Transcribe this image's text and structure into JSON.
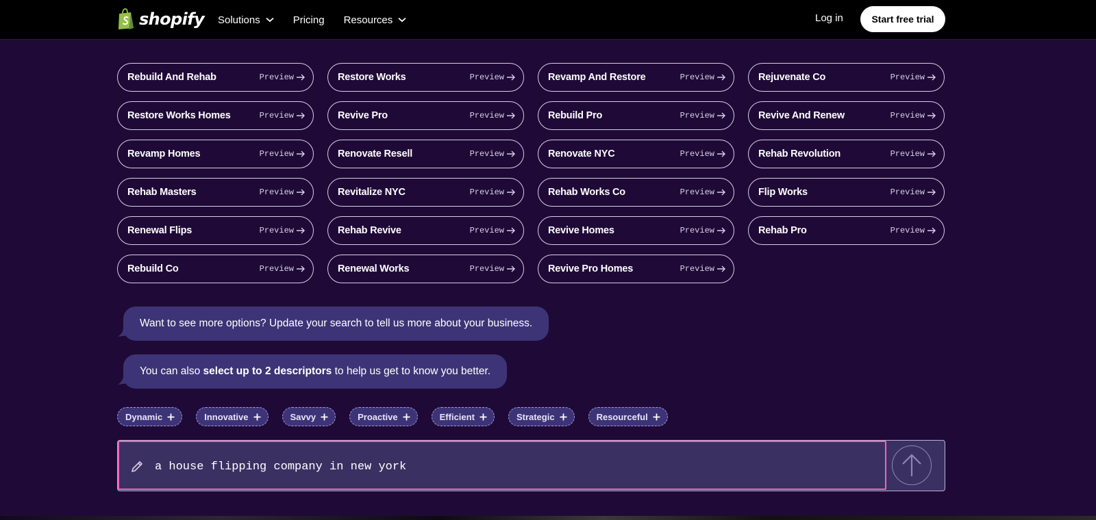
{
  "header": {
    "logo_text": "shopify",
    "nav": [
      {
        "label": "Solutions",
        "has_dropdown": true
      },
      {
        "label": "Pricing",
        "has_dropdown": false
      },
      {
        "label": "Resources",
        "has_dropdown": true
      }
    ],
    "login_label": "Log in",
    "cta_label": "Start free trial"
  },
  "names": {
    "preview_label": "Preview",
    "items": [
      "Rebuild And Rehab",
      "Restore Works",
      "Revamp And Restore",
      "Rejuvenate Co",
      "Restore Works Homes",
      "Revive Pro",
      "Rebuild Pro",
      "Revive And Renew",
      "Revamp Homes",
      "Renovate Resell",
      "Renovate NYC",
      "Rehab Revolution",
      "Rehab Masters",
      "Revitalize NYC",
      "Rehab Works Co",
      "Flip Works",
      "Renewal Flips",
      "Rehab Revive",
      "Revive Homes",
      "Rehab Pro",
      "Rebuild Co",
      "Renewal Works",
      "Revive Pro Homes"
    ]
  },
  "chat": {
    "bubble1": "Want to see more options? Update your search to tell us more about your business.",
    "bubble2_pre": "You can also ",
    "bubble2_bold": "select up to 2 descriptors",
    "bubble2_post": " to help us get to know you better."
  },
  "descriptors": [
    "Dynamic",
    "Innovative",
    "Savvy",
    "Proactive",
    "Efficient",
    "Strategic",
    "Resourceful"
  ],
  "search": {
    "value": "a house flipping company in new york"
  },
  "colors": {
    "background": "#1f0a37",
    "bubble": "#3d3477",
    "focus_border": "#f067b5",
    "logo_green": "#95bf47"
  }
}
